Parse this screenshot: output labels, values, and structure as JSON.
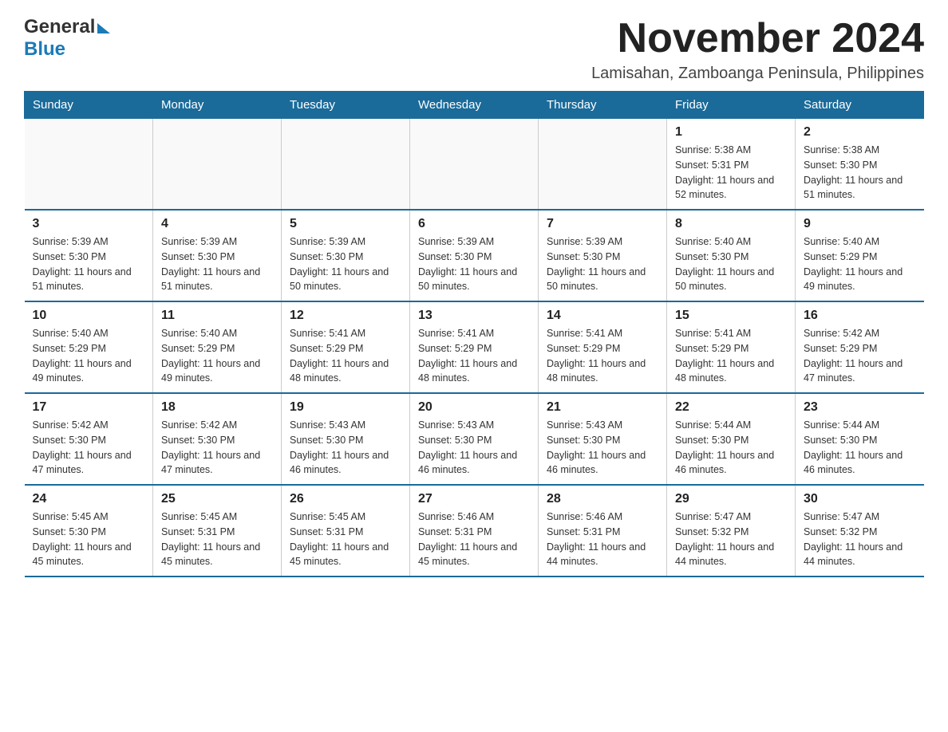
{
  "logo": {
    "text_general": "General",
    "text_blue": "Blue"
  },
  "header": {
    "month_title": "November 2024",
    "subtitle": "Lamisahan, Zamboanga Peninsula, Philippines"
  },
  "days_of_week": [
    "Sunday",
    "Monday",
    "Tuesday",
    "Wednesday",
    "Thursday",
    "Friday",
    "Saturday"
  ],
  "weeks": [
    [
      {
        "day": "",
        "info": ""
      },
      {
        "day": "",
        "info": ""
      },
      {
        "day": "",
        "info": ""
      },
      {
        "day": "",
        "info": ""
      },
      {
        "day": "",
        "info": ""
      },
      {
        "day": "1",
        "info": "Sunrise: 5:38 AM\nSunset: 5:31 PM\nDaylight: 11 hours and 52 minutes."
      },
      {
        "day": "2",
        "info": "Sunrise: 5:38 AM\nSunset: 5:30 PM\nDaylight: 11 hours and 51 minutes."
      }
    ],
    [
      {
        "day": "3",
        "info": "Sunrise: 5:39 AM\nSunset: 5:30 PM\nDaylight: 11 hours and 51 minutes."
      },
      {
        "day": "4",
        "info": "Sunrise: 5:39 AM\nSunset: 5:30 PM\nDaylight: 11 hours and 51 minutes."
      },
      {
        "day": "5",
        "info": "Sunrise: 5:39 AM\nSunset: 5:30 PM\nDaylight: 11 hours and 50 minutes."
      },
      {
        "day": "6",
        "info": "Sunrise: 5:39 AM\nSunset: 5:30 PM\nDaylight: 11 hours and 50 minutes."
      },
      {
        "day": "7",
        "info": "Sunrise: 5:39 AM\nSunset: 5:30 PM\nDaylight: 11 hours and 50 minutes."
      },
      {
        "day": "8",
        "info": "Sunrise: 5:40 AM\nSunset: 5:30 PM\nDaylight: 11 hours and 50 minutes."
      },
      {
        "day": "9",
        "info": "Sunrise: 5:40 AM\nSunset: 5:29 PM\nDaylight: 11 hours and 49 minutes."
      }
    ],
    [
      {
        "day": "10",
        "info": "Sunrise: 5:40 AM\nSunset: 5:29 PM\nDaylight: 11 hours and 49 minutes."
      },
      {
        "day": "11",
        "info": "Sunrise: 5:40 AM\nSunset: 5:29 PM\nDaylight: 11 hours and 49 minutes."
      },
      {
        "day": "12",
        "info": "Sunrise: 5:41 AM\nSunset: 5:29 PM\nDaylight: 11 hours and 48 minutes."
      },
      {
        "day": "13",
        "info": "Sunrise: 5:41 AM\nSunset: 5:29 PM\nDaylight: 11 hours and 48 minutes."
      },
      {
        "day": "14",
        "info": "Sunrise: 5:41 AM\nSunset: 5:29 PM\nDaylight: 11 hours and 48 minutes."
      },
      {
        "day": "15",
        "info": "Sunrise: 5:41 AM\nSunset: 5:29 PM\nDaylight: 11 hours and 48 minutes."
      },
      {
        "day": "16",
        "info": "Sunrise: 5:42 AM\nSunset: 5:29 PM\nDaylight: 11 hours and 47 minutes."
      }
    ],
    [
      {
        "day": "17",
        "info": "Sunrise: 5:42 AM\nSunset: 5:30 PM\nDaylight: 11 hours and 47 minutes."
      },
      {
        "day": "18",
        "info": "Sunrise: 5:42 AM\nSunset: 5:30 PM\nDaylight: 11 hours and 47 minutes."
      },
      {
        "day": "19",
        "info": "Sunrise: 5:43 AM\nSunset: 5:30 PM\nDaylight: 11 hours and 46 minutes."
      },
      {
        "day": "20",
        "info": "Sunrise: 5:43 AM\nSunset: 5:30 PM\nDaylight: 11 hours and 46 minutes."
      },
      {
        "day": "21",
        "info": "Sunrise: 5:43 AM\nSunset: 5:30 PM\nDaylight: 11 hours and 46 minutes."
      },
      {
        "day": "22",
        "info": "Sunrise: 5:44 AM\nSunset: 5:30 PM\nDaylight: 11 hours and 46 minutes."
      },
      {
        "day": "23",
        "info": "Sunrise: 5:44 AM\nSunset: 5:30 PM\nDaylight: 11 hours and 46 minutes."
      }
    ],
    [
      {
        "day": "24",
        "info": "Sunrise: 5:45 AM\nSunset: 5:30 PM\nDaylight: 11 hours and 45 minutes."
      },
      {
        "day": "25",
        "info": "Sunrise: 5:45 AM\nSunset: 5:31 PM\nDaylight: 11 hours and 45 minutes."
      },
      {
        "day": "26",
        "info": "Sunrise: 5:45 AM\nSunset: 5:31 PM\nDaylight: 11 hours and 45 minutes."
      },
      {
        "day": "27",
        "info": "Sunrise: 5:46 AM\nSunset: 5:31 PM\nDaylight: 11 hours and 45 minutes."
      },
      {
        "day": "28",
        "info": "Sunrise: 5:46 AM\nSunset: 5:31 PM\nDaylight: 11 hours and 44 minutes."
      },
      {
        "day": "29",
        "info": "Sunrise: 5:47 AM\nSunset: 5:32 PM\nDaylight: 11 hours and 44 minutes."
      },
      {
        "day": "30",
        "info": "Sunrise: 5:47 AM\nSunset: 5:32 PM\nDaylight: 11 hours and 44 minutes."
      }
    ]
  ]
}
